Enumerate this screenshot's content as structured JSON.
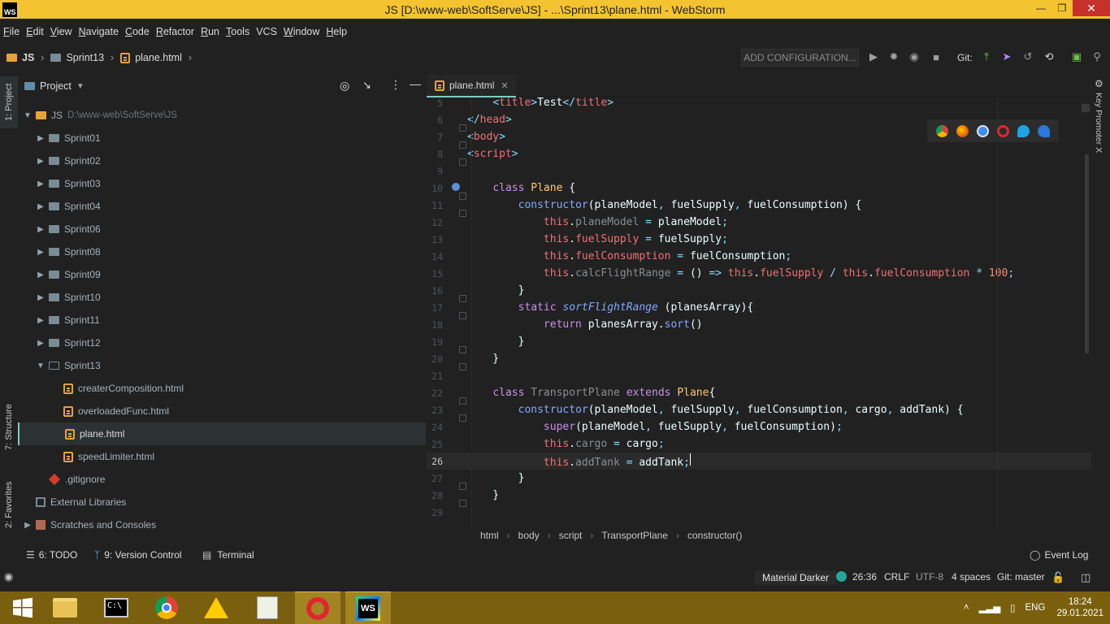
{
  "window": {
    "app_icon_text": "WS",
    "title": "JS [D:\\www-web\\SoftServe\\JS] - ...\\Sprint13\\plane.html - WebStorm"
  },
  "menu": [
    {
      "label": "File",
      "u": "F",
      "rest": "ile"
    },
    {
      "label": "Edit",
      "u": "E",
      "rest": "dit"
    },
    {
      "label": "View",
      "u": "V",
      "rest": "iew"
    },
    {
      "label": "Navigate",
      "u": "N",
      "rest": "avigate"
    },
    {
      "label": "Code",
      "u": "C",
      "rest": "ode"
    },
    {
      "label": "Refactor",
      "u": "R",
      "rest": "efactor"
    },
    {
      "label": "Run",
      "u": "R",
      "rest": "un"
    },
    {
      "label": "Tools",
      "u": "T",
      "rest": "ools"
    },
    {
      "label": "VCS",
      "u": "",
      "rest": "VCS"
    },
    {
      "label": "Window",
      "u": "W",
      "rest": "indow"
    },
    {
      "label": "Help",
      "u": "H",
      "rest": "elp"
    }
  ],
  "nav": {
    "crumbs": [
      "JS",
      "Sprint13",
      "plane.html"
    ],
    "add_config": "ADD CONFIGURATION...",
    "git_label": "Git:"
  },
  "left_tabs": {
    "project": "1: Project",
    "structure": "7: Structure",
    "favorites": "2: Favorites"
  },
  "project": {
    "header": "Project",
    "root_name": "JS",
    "root_path": "D:\\www-web\\SoftServe\\JS",
    "folders": [
      "Sprint01",
      "Sprint02",
      "Sprint03",
      "Sprint04",
      "Sprint06",
      "Sprint08",
      "Sprint09",
      "Sprint10",
      "Sprint11",
      "Sprint12"
    ],
    "open_folder": "Sprint13",
    "files": [
      "createrComposition.html",
      "overloadedFunc.html",
      "plane.html",
      "speedLimiter.html"
    ],
    "selected_file": "plane.html",
    "gitignore": ".gitignore",
    "external": "External Libraries",
    "scratches": "Scratches and Consoles"
  },
  "editor": {
    "tab": "plane.html",
    "line_numbers": [
      "5",
      "6",
      "7",
      "8",
      "9",
      "10",
      "11",
      "12",
      "13",
      "14",
      "15",
      "16",
      "17",
      "18",
      "19",
      "20",
      "21",
      "22",
      "23",
      "24",
      "25",
      "26",
      "27",
      "28",
      "29"
    ],
    "current_line": "26"
  },
  "breadcrumbs": [
    "html",
    "body",
    "script",
    "TransportPlane",
    "constructor()"
  ],
  "right_tab": "Key Promoter X",
  "toolwindows": {
    "todo": "6: TODO",
    "vcs": "9: Version Control",
    "terminal": "Terminal",
    "event_log": "Event Log"
  },
  "status": {
    "theme": "Material Darker",
    "position": "26:36",
    "line_sep": "CRLF",
    "encoding": "UTF-8",
    "indent": "4 spaces",
    "git": "Git: master"
  },
  "taskbar": {
    "lang": "ENG",
    "time": "18:24",
    "date": "29.01.2021"
  },
  "colors": {
    "titlebar": "#f4c430",
    "taskbar": "#7a5f0e",
    "accent": "#80cbc4"
  }
}
